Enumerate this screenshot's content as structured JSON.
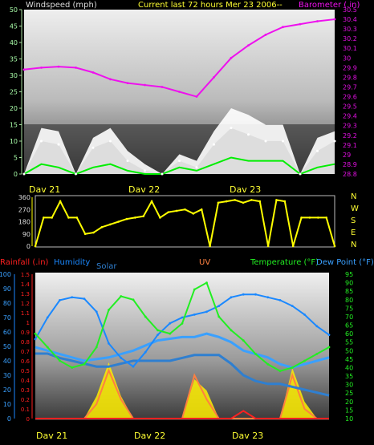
{
  "colors": {
    "background": "#000000",
    "wind": "#ffffff",
    "gust": "#00ee00",
    "wind_axis": "#a8e0a0",
    "barometer": "#ee11ee",
    "baro_axis": "#e010e0",
    "direction": "#ffff00",
    "dir_axis_bars": "#ffff00",
    "rainfall": "#ff2020",
    "humidity": "#1a88ff",
    "solar": "#2f7fd0",
    "uv": "#ff8040",
    "temperature": "#22ee22",
    "dew_point": "#3aa0ff",
    "title": "#ffff33",
    "left_axis_text": "#aaffaa"
  },
  "header": {
    "windspeed_label": "Windspeed (mph)",
    "title": "Current last 72 hours Mer 23 2006--",
    "barometer_label": "Barometer (.in)"
  },
  "lower_header": {
    "rainfall": "Rainfall (.in)",
    "humidity": "Humidity",
    "solar": "Solar",
    "uv": "UV",
    "temperature": "Temperature (°F)",
    "dew_point": "Dew Point (°F)"
  },
  "day_labels": [
    "Dav 21",
    "Dav 22",
    "Dav 23"
  ],
  "chart_data": [
    {
      "type": "line",
      "title": "Current last 72 hours Mer 23 2006--",
      "ylabel": "Windspeed (mph)",
      "y2label": "Barometer (.in)",
      "ylim": [
        0,
        50
      ],
      "y2lim": [
        28.8,
        30.5
      ],
      "yticks": [
        0,
        5,
        10,
        15,
        20,
        25,
        30,
        35,
        40,
        45,
        50
      ],
      "y2ticks": [
        "28.8",
        "28.9",
        "29",
        "29.1",
        "29.2",
        "29.3",
        "29.4",
        "29.5",
        "29.6",
        "29.7",
        "29.8",
        "29.9",
        "30",
        "30.1",
        "30.2",
        "30.3",
        "30.4",
        "30.5"
      ],
      "x_hours": [
        0,
        4,
        8,
        12,
        16,
        20,
        24,
        28,
        32,
        36,
        40,
        44,
        48,
        52,
        56,
        60,
        64,
        68,
        72
      ],
      "series": [
        {
          "name": "Windspeed (mph)",
          "values": [
            0,
            10,
            9,
            0,
            8,
            10,
            4,
            1,
            0,
            4,
            2,
            9,
            14,
            12,
            10,
            10,
            0,
            7,
            10
          ]
        },
        {
          "name": "Barometer (.in)",
          "values": [
            29.88,
            29.9,
            29.91,
            29.9,
            29.85,
            29.78,
            29.74,
            29.72,
            29.7,
            29.65,
            29.6,
            29.8,
            30.0,
            30.13,
            30.24,
            30.32,
            30.35,
            30.38,
            30.4
          ]
        }
      ],
      "gust_values": [
        0,
        3,
        2,
        0,
        2,
        3,
        1,
        0,
        0,
        2,
        1,
        3,
        5,
        4,
        4,
        4,
        0,
        2,
        3
      ],
      "wind_peak_values": [
        0,
        14,
        13,
        0,
        11,
        14,
        7,
        3,
        0,
        6,
        4,
        13,
        20,
        18,
        15,
        15,
        0,
        11,
        13
      ]
    },
    {
      "type": "line",
      "ylim": [
        0,
        360
      ],
      "yticks": [
        0,
        90,
        180,
        270,
        360
      ],
      "compass": [
        "N",
        "W",
        "S",
        "E",
        "N"
      ],
      "x_hours": [
        0,
        2,
        4,
        6,
        8,
        10,
        12,
        14,
        16,
        18,
        20,
        22,
        24,
        26,
        28,
        30,
        32,
        34,
        36,
        38,
        40,
        42,
        44,
        46,
        48,
        50,
        52,
        54,
        56,
        58,
        60,
        62,
        64,
        66,
        68,
        70,
        72
      ],
      "series": [
        {
          "name": "Wind direction",
          "values": [
            0,
            210,
            210,
            330,
            210,
            210,
            90,
            100,
            140,
            160,
            180,
            200,
            210,
            220,
            330,
            210,
            250,
            260,
            270,
            240,
            270,
            0,
            320,
            330,
            340,
            320,
            340,
            330,
            0,
            340,
            330,
            0,
            210,
            210,
            210,
            210,
            0
          ]
        }
      ]
    },
    {
      "type": "line",
      "ylabel": "Rainfall (.in)",
      "ylim_left_humidity": [
        0,
        100
      ],
      "ylim_rain": [
        0,
        1.5
      ],
      "ylim_temp": [
        10,
        95
      ],
      "humidity_ticks": [
        0,
        10,
        20,
        30,
        40,
        50,
        60,
        70,
        80,
        90,
        100
      ],
      "rain_ticks": [
        "0",
        "0.1",
        "0.2",
        "0.3",
        "0.4",
        "0.5",
        "0.6",
        "0.7",
        "0.8",
        "0.9",
        "1",
        "1.1",
        "1.2",
        "1.3",
        "1.4",
        "1.5"
      ],
      "temp_ticks": [
        10,
        15,
        20,
        25,
        30,
        35,
        40,
        45,
        50,
        55,
        60,
        65,
        70,
        75,
        80,
        85,
        90,
        95
      ],
      "x_hours": [
        0,
        3,
        6,
        9,
        12,
        15,
        18,
        21,
        24,
        27,
        30,
        33,
        36,
        39,
        42,
        45,
        48,
        51,
        54,
        57,
        60,
        63,
        66,
        69,
        72
      ],
      "series": [
        {
          "name": "Humidity",
          "values": [
            55,
            70,
            82,
            84,
            83,
            74,
            52,
            42,
            36,
            46,
            58,
            66,
            70,
            72,
            74,
            78,
            84,
            86,
            86,
            84,
            82,
            78,
            72,
            64,
            58
          ]
        },
        {
          "name": "Temperature (°F)",
          "values": [
            60,
            52,
            44,
            40,
            42,
            52,
            74,
            82,
            80,
            70,
            62,
            60,
            66,
            86,
            90,
            70,
            62,
            56,
            48,
            42,
            38,
            40,
            44,
            48,
            52
          ]
        },
        {
          "name": "Dew Point (°F)",
          "values": [
            52,
            50,
            48,
            46,
            44,
            45,
            46,
            48,
            50,
            53,
            56,
            57,
            58,
            58,
            60,
            58,
            55,
            50,
            48,
            46,
            42,
            40,
            42,
            44,
            46
          ]
        },
        {
          "name": "Solar",
          "values": [
            45,
            45,
            42,
            40,
            38,
            36,
            36,
            38,
            40,
            40,
            40,
            40,
            42,
            44,
            44,
            44,
            38,
            30,
            26,
            24,
            24,
            22,
            20,
            18,
            16
          ]
        },
        {
          "name": "UV",
          "values": [
            0,
            0,
            0,
            0,
            0,
            0.15,
            0.5,
            0.2,
            0,
            0,
            0,
            0,
            0,
            0.45,
            0.2,
            0,
            0,
            0,
            0,
            0,
            0,
            0.45,
            0.1,
            0,
            0
          ]
        },
        {
          "name": "Rainfall (.in)",
          "values": [
            0,
            0,
            0,
            0,
            0,
            0,
            0,
            0,
            0,
            0,
            0,
            0,
            0,
            0,
            0,
            0,
            0,
            0.08,
            0,
            0,
            0,
            0,
            0,
            0,
            0
          ]
        }
      ],
      "sun_values": [
        0,
        0,
        0,
        0,
        0,
        0.4,
        1.0,
        0.4,
        0,
        0,
        0,
        0,
        0,
        0.7,
        0.5,
        0,
        0,
        0,
        0,
        0,
        0,
        0.9,
        0.3,
        0,
        0
      ]
    }
  ]
}
